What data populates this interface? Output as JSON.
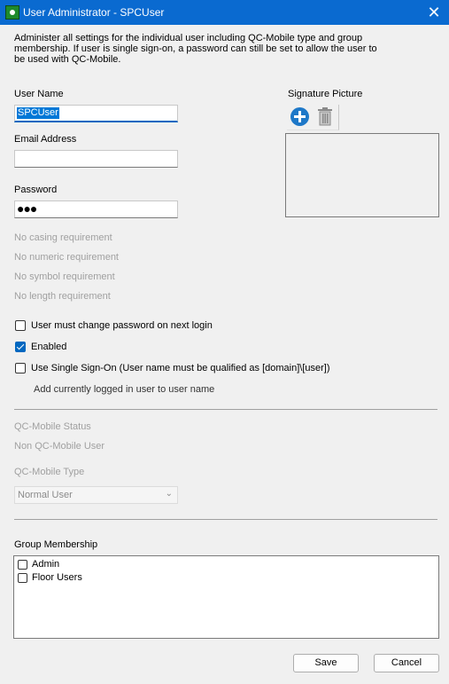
{
  "window": {
    "title": "User Administrator - SPCUser"
  },
  "description": "Administer all settings for the individual user including QC-Mobile type and group membership. If user is single sign-on, a password can still be set to allow the user to be used with QC-Mobile.",
  "user_name": {
    "label": "User Name",
    "value": "SPCUser"
  },
  "email": {
    "label": "Email Address",
    "value": ""
  },
  "password": {
    "label": "Password",
    "masked": "●●●"
  },
  "requirements": [
    "No casing requirement",
    "No numeric requirement",
    "No symbol requirement",
    "No length requirement"
  ],
  "options": {
    "must_change": {
      "label": "User must change password on next login",
      "checked": false
    },
    "enabled": {
      "label": "Enabled",
      "checked": true
    },
    "sso": {
      "label": "Use Single Sign-On (User name must be qualified as [domain]\\[user])",
      "checked": false
    }
  },
  "add_logged_in_link": "Add currently logged in user to user name",
  "qc_mobile": {
    "status_label": "QC-Mobile Status",
    "status_value": "Non QC-Mobile User",
    "type_label": "QC-Mobile Type",
    "type_value": "Normal User"
  },
  "signature": {
    "label": "Signature Picture",
    "add_icon": "add-icon",
    "delete_icon": "trash-icon"
  },
  "group_membership": {
    "label": "Group Membership",
    "groups": [
      {
        "name": "Admin",
        "checked": false
      },
      {
        "name": "Floor Users",
        "checked": false
      }
    ]
  },
  "buttons": {
    "save_label": "Save",
    "cancel_label": "Cancel"
  },
  "colors": {
    "accent": "#0067c0",
    "titlebar": "#0a6ad0"
  }
}
